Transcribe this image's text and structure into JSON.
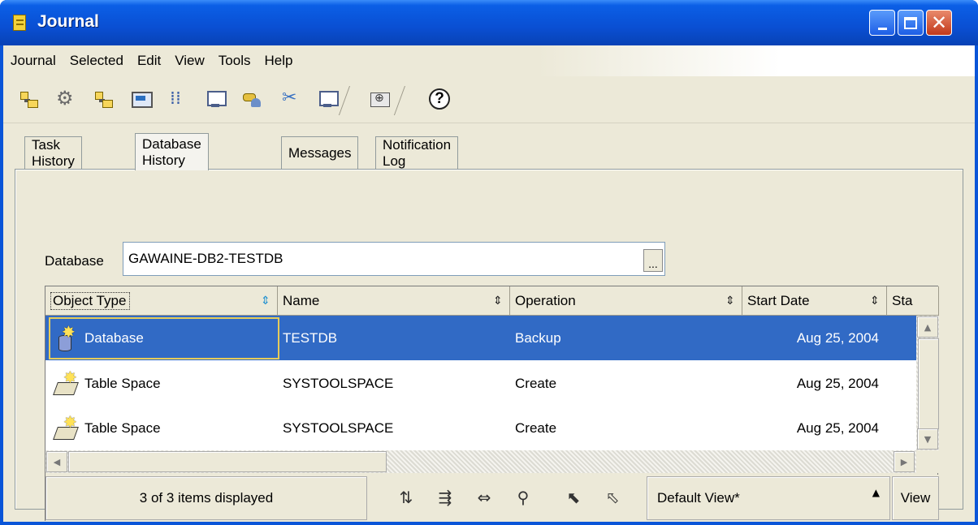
{
  "window": {
    "title": "Journal"
  },
  "menu": [
    "Journal",
    "Selected",
    "Edit",
    "View",
    "Tools",
    "Help"
  ],
  "toolbar": {
    "icons": [
      "control-center-icon",
      "replication-center-icon",
      "satellite-admin-icon",
      "command-editor-icon",
      "task-center-icon",
      "health-center-icon",
      "license-center-icon",
      "tools-settings-icon",
      "information-catalog-icon",
      "custom-tools-icon",
      "help-icon"
    ],
    "help_glyph": "?"
  },
  "tabs": [
    {
      "label": "Task History",
      "active": false
    },
    {
      "label": "Database History",
      "active": true
    },
    {
      "label": "Messages",
      "active": false
    },
    {
      "label": "Notification Log",
      "active": false
    }
  ],
  "database": {
    "label": "Database",
    "value": "GAWAINE-DB2-TESTDB",
    "browse_label": "..."
  },
  "table": {
    "columns": [
      "Object Type",
      "Name",
      "Operation",
      "Start Date",
      "Sta"
    ],
    "rows": [
      {
        "object_type": "Database",
        "name": "TESTDB",
        "operation": "Backup",
        "start_date": "Aug 25, 2004",
        "icon": "database-icon",
        "selected": true
      },
      {
        "object_type": "Table Space",
        "name": "SYSTOOLSPACE",
        "operation": "Create",
        "start_date": "Aug 25, 2004",
        "icon": "tablespace-icon",
        "selected": false
      },
      {
        "object_type": "Table Space",
        "name": "SYSTOOLSPACE",
        "operation": "Create",
        "start_date": "Aug 25, 2004",
        "icon": "tablespace-icon",
        "selected": false
      }
    ]
  },
  "status": {
    "count": "3 of 3 items displayed",
    "view_name": "Default View*",
    "view_button": "View",
    "tools": [
      "sort-icon",
      "filter-icon",
      "customize-columns-icon",
      "find-icon",
      "select-all-icon",
      "deselect-all-icon"
    ]
  }
}
